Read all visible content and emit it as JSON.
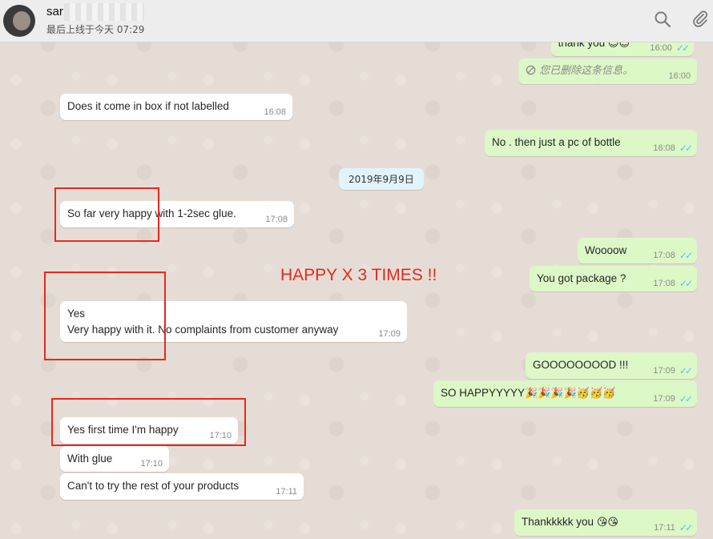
{
  "header": {
    "contact_name": "sar",
    "last_seen": "最后上线于今天 07:29"
  },
  "date_separator": "2019年9月9日",
  "messages": [
    {
      "id": "m1",
      "dir": "out",
      "text": "thank you",
      "emoji": "😊😊",
      "time": "16:00",
      "ticks": "✓✓"
    },
    {
      "id": "m2",
      "dir": "out",
      "text": "您已删除这条信息。",
      "time": "16:00",
      "deleted": true
    },
    {
      "id": "m3",
      "dir": "in",
      "text": "Does it come in box if not labelled",
      "time": "16:08"
    },
    {
      "id": "m4",
      "dir": "out",
      "text": "No . then just a pc of bottle",
      "time": "16:08",
      "ticks": "✓✓"
    },
    {
      "id": "m5",
      "dir": "in",
      "text": "So far very happy with 1-2sec glue.",
      "time": "17:08"
    },
    {
      "id": "m6",
      "dir": "out",
      "text": "Woooow",
      "time": "17:08",
      "ticks": "✓✓"
    },
    {
      "id": "m7",
      "dir": "out",
      "text": "You got package ?",
      "time": "17:08",
      "ticks": "✓✓"
    },
    {
      "id": "m8",
      "dir": "in",
      "line1": "Yes",
      "line2": "Very happy with it. No complaints from customer anyway",
      "time": "17:09"
    },
    {
      "id": "m9",
      "dir": "out",
      "text": "GOOOOOOOOD !!!",
      "time": "17:09",
      "ticks": "✓✓"
    },
    {
      "id": "m10",
      "dir": "out",
      "text": "SO HAPPYYYYY",
      "emoji": "🎉🎉🎉🎉🥳🥳🥳",
      "time": "17:09",
      "ticks": "✓✓"
    },
    {
      "id": "m11",
      "dir": "in",
      "text": "Yes first time I'm happy",
      "time": "17:10"
    },
    {
      "id": "m12",
      "dir": "in",
      "text": "With glue",
      "time": "17:10"
    },
    {
      "id": "m13",
      "dir": "in",
      "text": "Can't to try the rest of your products",
      "time": "17:11"
    },
    {
      "id": "m14",
      "dir": "out",
      "text": "Thankkkkk you",
      "emoji": "😘😘",
      "time": "17:11",
      "ticks": "✓✓"
    }
  ],
  "overlay_text": "HAPPY X 3 TIMES !!",
  "colors": {
    "incoming_bubble": "#ffffff",
    "outgoing_bubble": "#dcf8c6",
    "read_ticks": "#4fc3f7",
    "annotation_red": "#e8281e",
    "chat_background": "#e5ddd5"
  },
  "icons": [
    "search-icon",
    "attach-icon",
    "deleted-icon"
  ]
}
